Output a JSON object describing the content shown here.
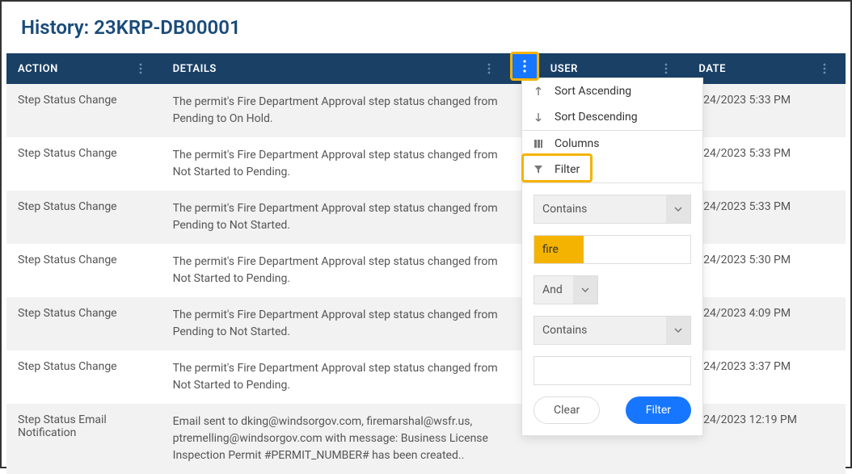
{
  "page": {
    "title": "History: 23KRP-DB00001"
  },
  "columns": {
    "action": "ACTION",
    "details": "DETAILS",
    "user": "USER",
    "date": "DATE"
  },
  "rows": [
    {
      "action": "Step Status Change",
      "details": "The permit's Fire Department Approval step status changed from Pending to On Hold.",
      "date": "/24/2023 5:33 PM"
    },
    {
      "action": "Step Status Change",
      "details": "The permit's Fire Department Approval step status changed from Not Started to Pending.",
      "date": "/24/2023 5:33 PM"
    },
    {
      "action": "Step Status Change",
      "details": "The permit's Fire Department Approval step status changed from Pending to Not Started.",
      "date": "/24/2023 5:33 PM"
    },
    {
      "action": "Step Status Change",
      "details": "The permit's Fire Department Approval step status changed from Not Started to Pending.",
      "date": "/24/2023 5:30 PM"
    },
    {
      "action": "Step Status Change",
      "details": "The permit's Fire Department Approval step status changed from Pending to Not Started.",
      "date": "/24/2023 4:09 PM"
    },
    {
      "action": "Step Status Change",
      "details": "The permit's Fire Department Approval step status changed from Not Started to Pending.",
      "date": "/24/2023 3:37 PM"
    },
    {
      "action": "Step Status Email Notification",
      "details": "Email sent to dking@windsorgov.com, firemarshal@wsfr.us, ptremelling@windsorgov.com with message: Business License Inspection Permit #PERMIT_NUMBER# has been created..",
      "date": "/24/2023 12:19 PM"
    }
  ],
  "menu": {
    "sort_asc": "Sort Ascending",
    "sort_desc": "Sort Descending",
    "columns": "Columns",
    "filter": "Filter"
  },
  "filter_panel": {
    "operator1": "Contains",
    "value1": "fire",
    "logic": "And",
    "operator2": "Contains",
    "value2": "",
    "clear_label": "Clear",
    "filter_label": "Filter"
  }
}
